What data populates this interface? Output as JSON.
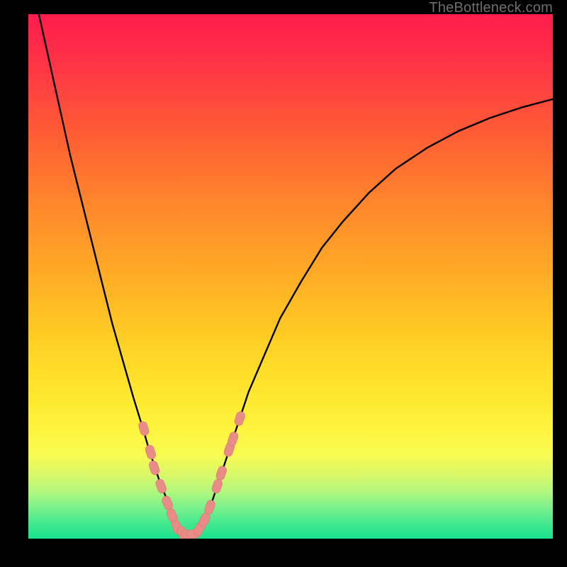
{
  "watermark": "TheBottleneck.com",
  "colors": {
    "frame": "#000000",
    "curve": "#000000",
    "marker_fill": "#e98b86",
    "marker_stroke": "#d6766f",
    "gradient_top": "#ff1d4c",
    "gradient_bottom": "#18e38f"
  },
  "chart_data": {
    "type": "line",
    "title": "",
    "xlabel": "",
    "ylabel": "",
    "xlim": [
      0,
      100
    ],
    "ylim": [
      0,
      100
    ],
    "axes_visible": false,
    "grid": false,
    "series": [
      {
        "name": "left-branch",
        "x": [
          2,
          4,
          6,
          8,
          10,
          12,
          14,
          16,
          18,
          20,
          22,
          23,
          24,
          25,
          26,
          27,
          28,
          28.5,
          29
        ],
        "y": [
          100,
          91,
          82,
          73,
          65,
          57,
          49,
          41,
          34,
          27,
          20.5,
          17,
          14,
          11,
          8.5,
          6,
          4,
          2.5,
          1.2
        ]
      },
      {
        "name": "valley-floor",
        "x": [
          29,
          30,
          31,
          32
        ],
        "y": [
          1.2,
          0.8,
          0.8,
          1.0
        ]
      },
      {
        "name": "right-branch",
        "x": [
          32,
          33,
          34,
          35,
          36,
          37,
          38,
          40,
          42,
          45,
          48,
          52,
          56,
          60,
          65,
          70,
          76,
          82,
          88,
          94,
          100
        ],
        "y": [
          1.0,
          2.5,
          4.5,
          7,
          10,
          13,
          16,
          22,
          28,
          35,
          42,
          49,
          55.5,
          60.5,
          66,
          70.5,
          74.5,
          77.7,
          80.2,
          82.2,
          83.8
        ]
      }
    ],
    "markers": {
      "name": "highlighted-points",
      "shape": "capsule",
      "points": [
        {
          "x": 22.0,
          "y": 21.0
        },
        {
          "x": 23.3,
          "y": 16.5
        },
        {
          "x": 24.0,
          "y": 13.5
        },
        {
          "x": 25.3,
          "y": 10.0
        },
        {
          "x": 26.5,
          "y": 6.8
        },
        {
          "x": 27.4,
          "y": 4.4
        },
        {
          "x": 28.3,
          "y": 2.2
        },
        {
          "x": 29.4,
          "y": 1.0
        },
        {
          "x": 30.4,
          "y": 0.8
        },
        {
          "x": 31.5,
          "y": 0.9
        },
        {
          "x": 32.6,
          "y": 1.9
        },
        {
          "x": 33.6,
          "y": 3.6
        },
        {
          "x": 34.6,
          "y": 6.0
        },
        {
          "x": 36.0,
          "y": 10.0
        },
        {
          "x": 36.8,
          "y": 12.5
        },
        {
          "x": 38.3,
          "y": 17.0
        },
        {
          "x": 39.0,
          "y": 19.0
        },
        {
          "x": 40.3,
          "y": 22.9
        }
      ]
    }
  }
}
